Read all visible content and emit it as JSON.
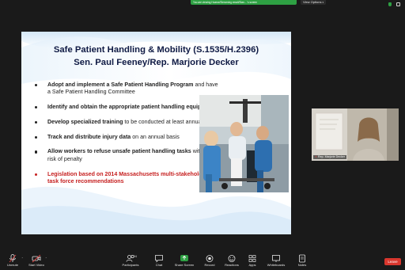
{
  "topbar": {
    "share_banner": "You are viewing Hoarse/Streaming email/Stan... 's screen",
    "view_options": "View Options"
  },
  "slide": {
    "title_line1": "Safe Patient Handling & Mobility (S.1535/H.2396)",
    "title_line2": "Sen. Paul Feeney/Rep. Marjorie Decker",
    "bullets": [
      {
        "bold": "Adopt and implement a Safe Patient Handling Program",
        "rest": " and have a  Safe Patient Handling Committee"
      },
      {
        "bold": "Identify and obtain the appropriate patient handling equipment",
        "rest": ""
      },
      {
        "bold": "Develop specialized training",
        "rest": " to be conducted at least annually"
      },
      {
        "bold": "Track and distribute injury data",
        "rest": " on an annual basis"
      },
      {
        "bold": "Allow workers to refuse unsafe patient handling tasks",
        "rest": " without risk of penalty"
      }
    ],
    "red_bullet": "Legislation based on 2014 Massachusetts multi-stakeholder task force recommendations"
  },
  "participant": {
    "name": "Rep. Marjorie Decker"
  },
  "toolbar": {
    "unmute": "Unmute",
    "start_video": "Start Video",
    "participants": "Participants",
    "participants_count": "24",
    "chat": "Chat",
    "share_screen": "Share Screen",
    "record": "Record",
    "reactions": "Reactions",
    "apps": "Apps",
    "whiteboards": "Whiteboards",
    "notes": "Notes",
    "leave": "Leave"
  },
  "colors": {
    "background": "#1a1a1a",
    "share_green": "#2ea043",
    "leave_red": "#d9372e",
    "slide_title": "#0f1a44",
    "red_text": "#c62020"
  },
  "icons": [
    "shield-icon",
    "grid-view-icon",
    "microphone-icon",
    "video-camera-icon",
    "participants-icon",
    "chat-icon",
    "share-screen-icon",
    "record-icon",
    "reactions-icon",
    "apps-icon",
    "whiteboard-icon",
    "notes-icon"
  ]
}
